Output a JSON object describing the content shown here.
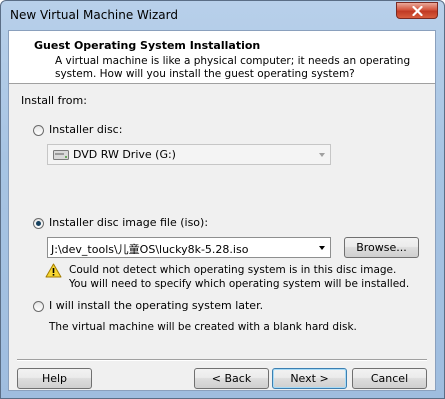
{
  "window": {
    "title": "New Virtual Machine Wizard"
  },
  "header": {
    "title": "Guest Operating System Installation",
    "description": "A virtual machine is like a physical computer; it needs an operating system. How will you install the guest operating system?"
  },
  "install_from": {
    "label": "Install from:"
  },
  "options": {
    "disc": {
      "label": "Installer disc:",
      "selected": false,
      "drive": "DVD RW Drive (G:)"
    },
    "iso": {
      "label": "Installer disc image file (iso):",
      "selected": true,
      "path": "J:\\dev_tools\\儿童OS\\lucky8k-5.28.iso",
      "browse_label": "Browse..."
    },
    "warning": {
      "line1": "Could not detect which operating system is in this disc image.",
      "line2": "You will need to specify which operating system will be installed."
    },
    "later": {
      "label": "I will install the operating system later.",
      "selected": false,
      "description": "The virtual machine will be created with a blank hard disk."
    }
  },
  "footer": {
    "help_label": "Help",
    "back_label": "< Back",
    "next_label": "Next >",
    "cancel_label": "Cancel"
  },
  "icons": {
    "close": "close-icon",
    "drive": "dvd-drive-icon",
    "warning": "warning-icon"
  }
}
